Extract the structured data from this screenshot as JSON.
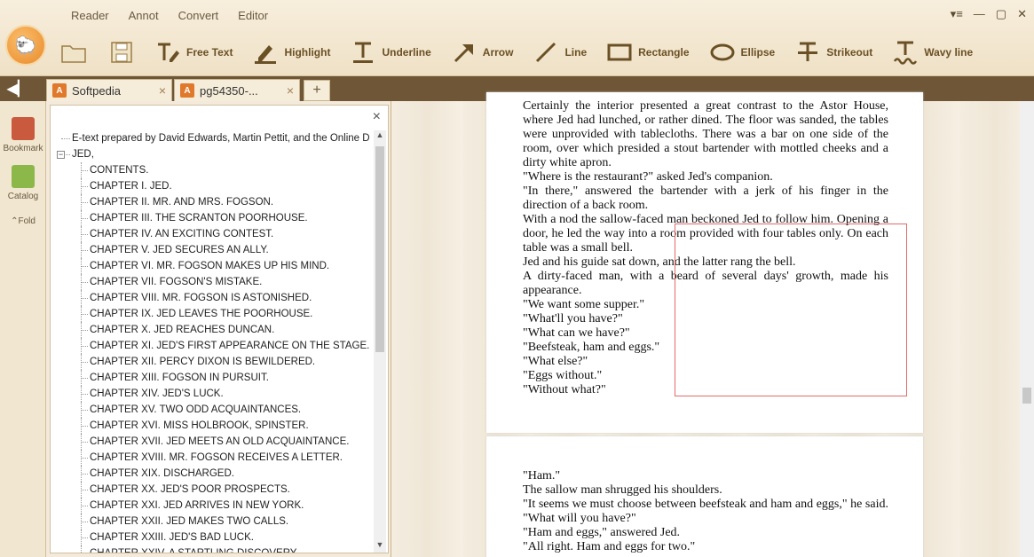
{
  "menu": [
    "Reader",
    "Annot",
    "Convert",
    "Editor"
  ],
  "window_controls": [
    "▾≡",
    "—",
    "▢",
    "✕"
  ],
  "tools": [
    {
      "label": "Free Text",
      "icon": "free-text-icon"
    },
    {
      "label": "Highlight",
      "icon": "highlight-icon"
    },
    {
      "label": "Underline",
      "icon": "underline-icon"
    },
    {
      "label": "Arrow",
      "icon": "arrow-icon"
    },
    {
      "label": "Line",
      "icon": "line-icon"
    },
    {
      "label": "Rectangle",
      "icon": "rectangle-icon"
    },
    {
      "label": "Ellipse",
      "icon": "ellipse-icon"
    },
    {
      "label": "Strikeout",
      "icon": "strikeout-icon"
    },
    {
      "label": "Wavy line",
      "icon": "wavy-line-icon"
    }
  ],
  "tabs": [
    {
      "label": "Softpedia",
      "close": "×"
    },
    {
      "label": "pg54350-...",
      "close": "×"
    }
  ],
  "tab_add": "+",
  "rail": {
    "bookmark": "Bookmark",
    "catalog": "Catalog",
    "fold": "Fold"
  },
  "catalog": {
    "close": "×",
    "root_items": [
      "E-text prepared by David Edwards, Martin Pettit, and the Online D",
      "JED,"
    ],
    "chapters": [
      "CONTENTS.",
      "CHAPTER I. JED.",
      "CHAPTER II. MR. AND MRS. FOGSON.",
      "CHAPTER III. THE SCRANTON POORHOUSE.",
      "CHAPTER IV. AN EXCITING CONTEST.",
      "CHAPTER V. JED SECURES AN ALLY.",
      "CHAPTER VI. MR. FOGSON MAKES UP HIS MIND.",
      "CHAPTER VII. FOGSON'S MISTAKE.",
      "CHAPTER VIII. MR. FOGSON IS ASTONISHED.",
      "CHAPTER IX. JED LEAVES THE POORHOUSE.",
      "CHAPTER X. JED REACHES DUNCAN.",
      "CHAPTER XI. JED'S FIRST APPEARANCE ON THE STAGE.",
      "CHAPTER XII. PERCY DIXON IS BEWILDERED.",
      "CHAPTER XIII. FOGSON IN PURSUIT.",
      "CHAPTER XIV. JED'S LUCK.",
      "CHAPTER XV. TWO ODD ACQUAINTANCES.",
      "CHAPTER XVI. MISS HOLBROOK, SPINSTER.",
      "CHAPTER XVII. JED MEETS AN OLD ACQUAINTANCE.",
      "CHAPTER XVIII. MR. FOGSON RECEIVES A LETTER.",
      "CHAPTER XIX. DISCHARGED.",
      "CHAPTER XX. JED'S POOR PROSPECTS.",
      "CHAPTER XXI. JED ARRIVES IN NEW YORK.",
      "CHAPTER XXII. JED MAKES TWO CALLS.",
      "CHAPTER XXIII. JED'S BAD LUCK.",
      "CHAPTER XXIV. A STARTLING DISCOVERY."
    ]
  },
  "page1_paragraphs": [
    "Certainly the interior presented a great contrast to the Astor House, where Jed had lunched, or rather dined. The floor was sanded, the tables were unprovided with tablecloths. There was a bar on one side of the room, over which presided a stout bartender with mottled cheeks and a dirty white apron.",
    "\"Where is the restaurant?\" asked Jed's companion.",
    "\"In there,\" answered the bartender with a jerk of his finger in the direction of a back room.",
    "With a nod the sallow-faced man beckoned Jed to follow him. Opening a door, he led the way into a room provided with four tables only. On each table was a small bell.",
    "Jed and his guide sat down, and the latter rang the bell.",
    "A dirty-faced man, with a beard of several days' growth, made his appearance.",
    "\"We want some supper.\"",
    "\"What'll you have?\"",
    "\"What can we have?\"",
    "\"Beefsteak, ham and eggs.\"",
    "\"What else?\"",
    "\"Eggs without.\"",
    "\"Without what?\""
  ],
  "page2_paragraphs": [
    "\"Ham.\"",
    "The sallow man shrugged his shoulders.",
    "\"It seems we must choose between beefsteak and ham and eggs,\" he said. \"What will you have?\"",
    "\"Ham and eggs,\" answered Jed.",
    "\"All right. Ham and eggs for two.\""
  ],
  "colors": {
    "accent": "#e0792b",
    "tabbar": "#6e5637",
    "selection": "#e46a6a"
  }
}
